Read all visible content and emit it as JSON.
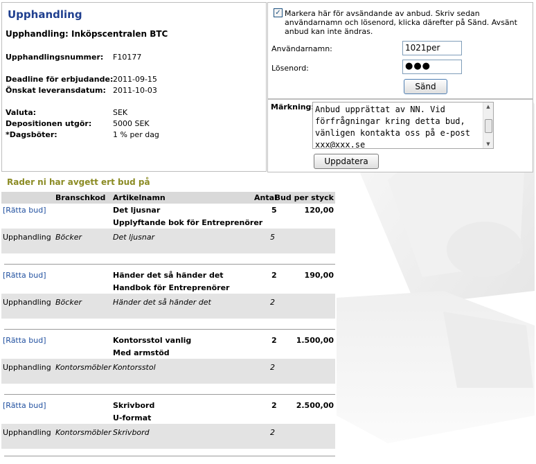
{
  "page_title": "Upphandling",
  "procurement_title": "Upphandling: Inköpscentralen BTC",
  "fields": {
    "number_label": "Upphandlingsnummer:",
    "number_value": "F10177",
    "deadline_label": "Deadline för erbjudande:",
    "deadline_value": "2011-09-15",
    "delivery_label": "Önskat leveransdatum:",
    "delivery_value": "2011-10-03",
    "currency_label": "Valuta:",
    "currency_value": "SEK",
    "deposit_label": "Depositionen utgör:",
    "deposit_value": "5000 SEK",
    "penalty_label": "*Dagsböter:",
    "penalty_value": "1 % per dag"
  },
  "login": {
    "checkbox_checked": true,
    "checkbox_text": "Markera här för avsändande av anbud. Skriv sedan användarnamn och lösenord, klicka därefter på Sänd. Avsänt anbud kan inte ändras.",
    "username_label": "Användarnamn:",
    "username_value": "1021per",
    "password_label": "Lösenord:",
    "password_mask": "●●●",
    "send_label": "Sänd"
  },
  "marking": {
    "label": "Märkning:",
    "text": "Anbud upprättat av NN. Vid förfrågningar kring detta bud, vänligen kontakta oss på e-post xxx@xxx.se",
    "update_label": "Uppdatera"
  },
  "bids": {
    "heading": "Rader ni har avgett ert bud på",
    "headers": {
      "branch": "Branschkod",
      "article": "Artikelnamn",
      "quantity": "Antal",
      "price": "Bud per styck"
    },
    "link_label": "[Rätta bud]",
    "rows": [
      {
        "article": "Det ljusnar",
        "description": "Upplyftande bok för Entreprenörer",
        "quantity": "5",
        "price": "120,00",
        "type": "Upphandling",
        "branch": "Böcker",
        "article_ref": "Det ljusnar",
        "quantity_ref": "5"
      },
      {
        "article": "Händer det så händer det",
        "description": "Handbok för Entreprenörer",
        "quantity": "2",
        "price": "190,00",
        "type": "Upphandling",
        "branch": "Böcker",
        "article_ref": "Händer det så händer det",
        "quantity_ref": "2"
      },
      {
        "article": "Kontorsstol vanlig",
        "description": "Med armstöd",
        "quantity": "2",
        "price": "1.500,00",
        "type": "Upphandling",
        "branch": "Kontorsmöbler",
        "article_ref": "Kontorsstol",
        "quantity_ref": "2"
      },
      {
        "article": "Skrivbord",
        "description": "U-format",
        "quantity": "2",
        "price": "2.500,00",
        "type": "Upphandling",
        "branch": "Kontorsmöbler",
        "article_ref": "Skrivbord",
        "quantity_ref": "2"
      }
    ]
  },
  "colors": {
    "title_blue": "#1f3f8f",
    "heading_olive": "#8b8b24",
    "link_blue": "#1f4f9f",
    "header_gray": "#d9d9d9",
    "row_gray": "#e3e3e3"
  }
}
